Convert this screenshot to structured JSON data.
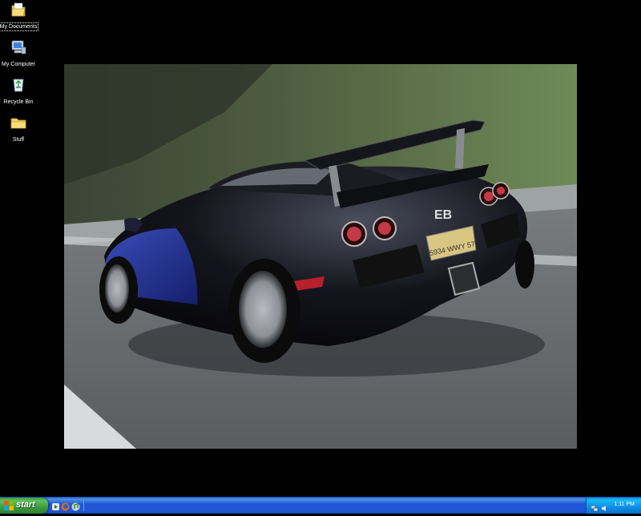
{
  "desktop": {
    "icons": [
      {
        "label": "My Documents",
        "icon": "my-documents-icon",
        "selected": true
      },
      {
        "label": "My Computer",
        "icon": "my-computer-icon"
      },
      {
        "label": "Recycle Bin",
        "icon": "recycle-bin-icon"
      },
      {
        "label": "Stuff",
        "icon": "folder-icon"
      }
    ],
    "wallpaper": {
      "subject": "sports-car-photo",
      "license_plate": "5934 WWY 57",
      "badge": "EB"
    },
    "background_color": "#000000"
  },
  "taskbar": {
    "start_label": "start",
    "quick_launch": [
      "media-player-icon",
      "firefox-icon",
      "music-player-icon"
    ],
    "tray_icons": [
      "network-icon",
      "volume-icon"
    ],
    "clock": "1:11 PM",
    "colors": {
      "taskbar": "#2157d7",
      "start": "#3e9c3e",
      "tray": "#0f8ee8"
    }
  }
}
